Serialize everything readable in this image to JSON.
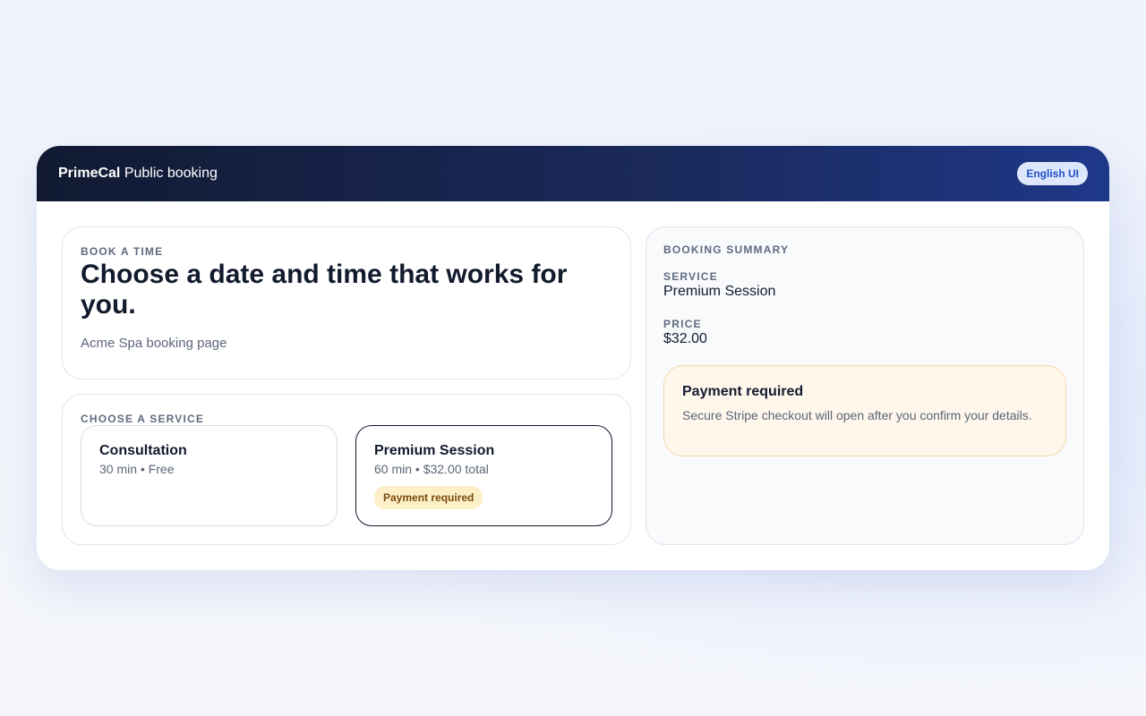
{
  "header": {
    "brand_bold": "PrimeCal",
    "brand_rest": " Public booking",
    "language_button": "English UI"
  },
  "hero": {
    "eyebrow": "BOOK A TIME",
    "title": "Choose a date and time that works for you.",
    "subtitle": "Acme Spa booking page"
  },
  "services": {
    "eyebrow": "CHOOSE A SERVICE",
    "items": [
      {
        "name": "Consultation",
        "meta": "30 min • Free",
        "badge": ""
      },
      {
        "name": "Premium Session",
        "meta": "60 min • $32.00 total",
        "badge": "Payment required"
      }
    ]
  },
  "summary": {
    "eyebrow": "BOOKING SUMMARY",
    "service_label": "SERVICE",
    "service_value": "Premium Session",
    "price_label": "PRICE",
    "price_value": "$32.00",
    "payment": {
      "title": "Payment required",
      "description": "Secure Stripe checkout will open after you confirm your details."
    }
  }
}
